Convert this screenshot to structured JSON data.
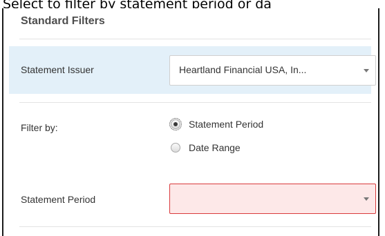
{
  "caption": "Select to filter by statement period or da",
  "panel": {
    "title": "Standard Filters"
  },
  "issuer": {
    "label": "Statement Issuer",
    "selected": "Heartland Financial USA, In..."
  },
  "filter_by": {
    "label": "Filter by:",
    "options": [
      {
        "label": "Statement Period",
        "checked": true
      },
      {
        "label": "Date Range",
        "checked": false
      }
    ]
  },
  "statement_period": {
    "label": "Statement Period",
    "selected": "",
    "error_color": "#d9393b",
    "error_bg": "#fde8e8"
  },
  "colors": {
    "issuer_row_bg": "#e3f0f9",
    "title_color": "#4d4d4d"
  }
}
